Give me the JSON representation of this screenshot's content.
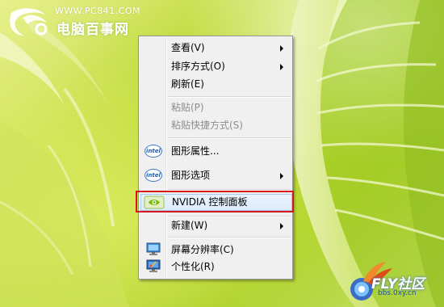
{
  "watermark": {
    "site": "WWW.PC841.COM",
    "title": "电脑百事网"
  },
  "context_menu": {
    "items": [
      {
        "label": "查看(V)",
        "has_submenu": true,
        "enabled": true,
        "icon": ""
      },
      {
        "label": "排序方式(O)",
        "has_submenu": true,
        "enabled": true,
        "icon": ""
      },
      {
        "label": "刷新(E)",
        "has_submenu": false,
        "enabled": true,
        "icon": ""
      },
      {
        "label": "粘贴(P)",
        "has_submenu": false,
        "enabled": false,
        "icon": ""
      },
      {
        "label": "粘贴快捷方式(S)",
        "has_submenu": false,
        "enabled": false,
        "icon": ""
      },
      {
        "label": "图形属性...",
        "has_submenu": false,
        "enabled": true,
        "icon": "intel-icon"
      },
      {
        "label": "图形选项",
        "has_submenu": true,
        "enabled": true,
        "icon": "intel-icon"
      },
      {
        "label": "NVIDIA 控制面板",
        "has_submenu": false,
        "enabled": true,
        "icon": "nvidia-icon",
        "highlighted": true
      },
      {
        "label": "新建(W)",
        "has_submenu": true,
        "enabled": true,
        "icon": ""
      },
      {
        "label": "屏幕分辨率(C)",
        "has_submenu": false,
        "enabled": true,
        "icon": "screen-resolution-icon"
      },
      {
        "label": "个性化(R)",
        "has_submenu": false,
        "enabled": true,
        "icon": "personalize-icon"
      }
    ],
    "intel_text": "intel",
    "highlight_color": "#d8141b"
  },
  "fly_logo": {
    "title": "FLY社区",
    "url": "bbs.0xy.cn"
  }
}
